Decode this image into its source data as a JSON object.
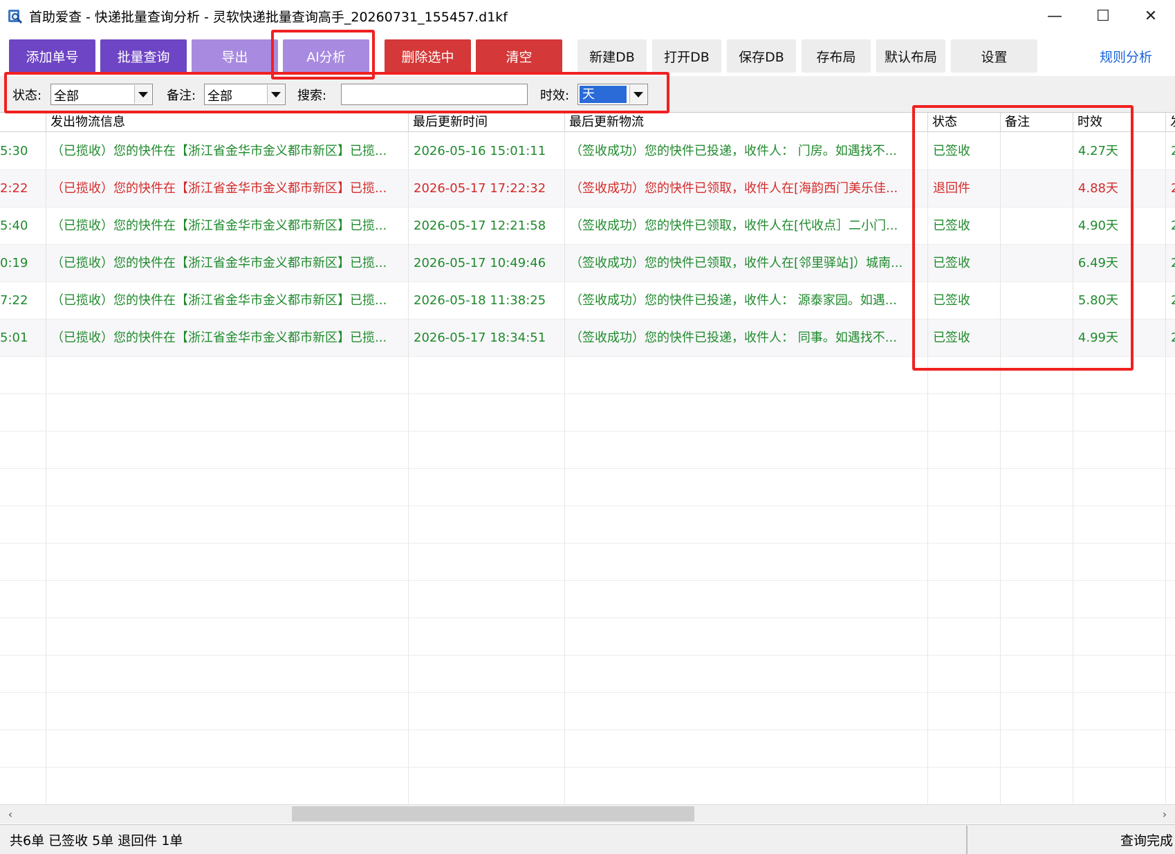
{
  "window": {
    "title": "首助爱查 - 快递批量查询分析 - 灵软快递批量查询高手_20260731_155457.d1kf",
    "minimize_glyph": "—",
    "maximize_glyph": "☐",
    "close_glyph": "✕"
  },
  "toolbar": {
    "add_label": "添加单号",
    "batch_query_label": "批量查询",
    "export_label": "导出",
    "ai_label": "AI分析",
    "delete_label": "删除选中",
    "clear_label": "清空",
    "new_db_label": "新建DB",
    "open_db_label": "打开DB",
    "save_db_label": "保存DB",
    "save_layout_label": "存布局",
    "default_layout_label": "默认布局",
    "settings_label": "设置",
    "rule_analysis_label": "规则分析"
  },
  "filters": {
    "status_label": "状态:",
    "status_value": "全部",
    "note_label": "备注:",
    "note_value": "全部",
    "search_label": "搜索:",
    "search_value": "",
    "timeliness_label": "时效:",
    "timeliness_value": "天"
  },
  "columns": {
    "c0": "",
    "c1": "发出物流信息",
    "c2": "最后更新时间",
    "c3": "最后更新物流",
    "c4": "状态",
    "c5": "备注",
    "c6": "时效",
    "c7": "发"
  },
  "rows": [
    {
      "c0": "5:30",
      "c1": "（已揽收）您的快件在【浙江省金华市金义都市新区】已揽...",
      "c2": "2026-05-16 15:01:11",
      "c3": "（签收成功）您的快件已投递，收件人： 门房。如遇找不...",
      "c4": "已签收",
      "c5": "",
      "c6": "4.27天",
      "c7": "2",
      "color": "#1f8a2c"
    },
    {
      "c0": "2:22",
      "c1": "（已揽收）您的快件在【浙江省金华市金义都市新区】已揽...",
      "c2": "2026-05-17 17:22:32",
      "c3": "（签收成功）您的快件已领取，收件人在[海韵西门美乐佳...",
      "c4": "退回件",
      "c5": "",
      "c6": "4.88天",
      "c7": "2",
      "color": "#d42a2a"
    },
    {
      "c0": "5:40",
      "c1": "（已揽收）您的快件在【浙江省金华市金义都市新区】已揽...",
      "c2": "2026-05-17 12:21:58",
      "c3": "（签收成功）您的快件已领取，收件人在[代收点］二小门...",
      "c4": "已签收",
      "c5": "",
      "c6": "4.90天",
      "c7": "2",
      "color": "#1f8a2c"
    },
    {
      "c0": "0:19",
      "c1": "（已揽收）您的快件在【浙江省金华市金义都市新区】已揽...",
      "c2": "2026-05-17 10:49:46",
      "c3": "（签收成功）您的快件已领取，收件人在[邻里驿站]）城南...",
      "c4": "已签收",
      "c5": "",
      "c6": "6.49天",
      "c7": "2",
      "color": "#1f8a2c"
    },
    {
      "c0": "7:22",
      "c1": "（已揽收）您的快件在【浙江省金华市金义都市新区】已揽...",
      "c2": "2026-05-18 11:38:25",
      "c3": "（签收成功）您的快件已投递，收件人： 源泰家园。如遇...",
      "c4": "已签收",
      "c5": "",
      "c6": "5.80天",
      "c7": "2",
      "color": "#1f8a2c"
    },
    {
      "c0": "5:01",
      "c1": "（已揽收）您的快件在【浙江省金华市金义都市新区】已揽...",
      "c2": "2026-05-17 18:34:51",
      "c3": "（签收成功）您的快件已投递，收件人： 同事。如遇找不...",
      "c4": "已签收",
      "c5": "",
      "c6": "4.99天",
      "c7": "2",
      "color": "#1f8a2c"
    }
  ],
  "status_bar": {
    "summary": "共6单  已签收 5单  退回件 1单",
    "state": "查询完成"
  },
  "colors": {
    "accent_purple": "#6e45c4",
    "light_purple": "#a88ae0",
    "danger_red": "#d43838",
    "signed_green": "#1f8a2c",
    "returned_red": "#d42a2a",
    "highlight_red": "#f02020"
  }
}
